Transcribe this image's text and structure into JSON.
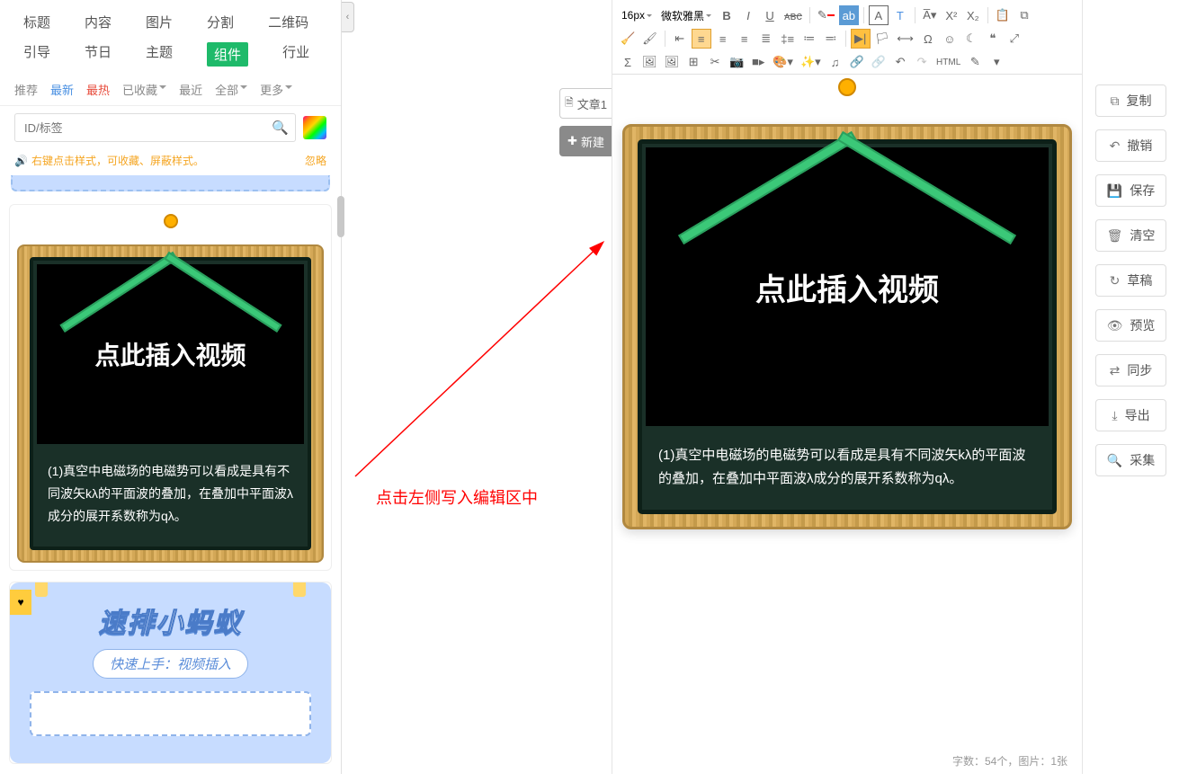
{
  "categories": {
    "row1": [
      "标题",
      "内容",
      "图片",
      "分割",
      "二维码"
    ],
    "row2": [
      "引导",
      "节日",
      "主题",
      "组件",
      "行业"
    ],
    "active": "组件"
  },
  "filters": {
    "recommend": "推荐",
    "newest": "最新",
    "hottest": "最热",
    "favorited": "已收藏",
    "recent": "最近",
    "all": "全部",
    "more": "更多"
  },
  "search": {
    "placeholder": "ID/标签"
  },
  "hint": {
    "text": "右键点击样式，可收藏、屏蔽样式。",
    "ignore": "忽略"
  },
  "templates": {
    "blackboard": {
      "video_label": "点此插入视频",
      "body": "(1)真空中电磁场的电磁势可以看成是具有不同波矢kλ的平面波的叠加，在叠加中平面波λ成分的展开系数称为qλ。"
    },
    "blue": {
      "title": "速排小蚂蚁",
      "subtitle": "快速上手：视频插入"
    }
  },
  "doc_tabs": {
    "article": "文章1",
    "new": "新建"
  },
  "instruction": "点击左侧写入编辑区中",
  "toolbar": {
    "font_size": "16px",
    "font_family": "微软雅黑",
    "html": "HTML"
  },
  "canvas": {
    "video_label": "点此插入视频",
    "body": "(1)真空中电磁场的电磁势可以看成是具有不同波矢kλ的平面波的叠加，在叠加中平面波λ成分的展开系数称为qλ。"
  },
  "footer": {
    "stats": "字数：54个，图片：1张"
  },
  "actions": {
    "copy": "复制",
    "undo": "撤销",
    "save": "保存",
    "clear": "清空",
    "draft": "草稿",
    "preview": "预览",
    "sync": "同步",
    "export": "导出",
    "collect": "采集"
  }
}
